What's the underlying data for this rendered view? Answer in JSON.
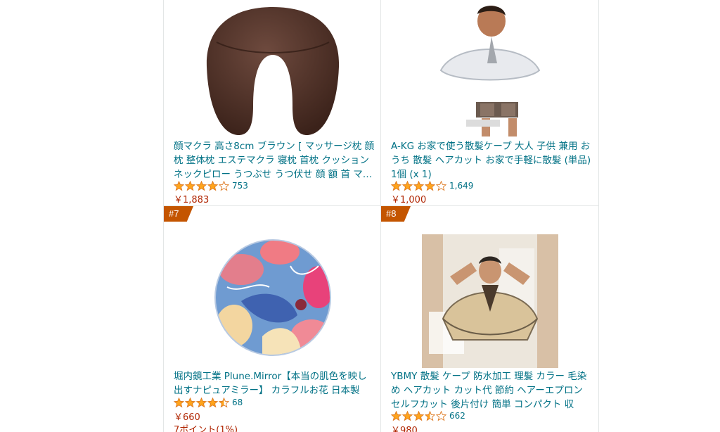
{
  "colors": {
    "link": "#007185",
    "price": "#b12704",
    "badge": "#c45500",
    "star": "#ffa41c",
    "divider": "#e3e6e6"
  },
  "products": [
    {
      "rank": "",
      "title": "顔マクラ 高さ8cm ブラウン [ マッサージ枕 顔枕 整体枕 エステマクラ 寝枕 首枕 クッション ネックピロー うつぶせ うつ伏せ 顔 額 首 マ…",
      "stars": 4.0,
      "review_count": "753",
      "price": "￥1,883",
      "points": "",
      "image_icon": "face-pillow-image"
    },
    {
      "rank": "",
      "title": "A-KG お家で使う散髪ケープ 大人 子供 兼用 おうち 散髪 ヘアカット お家で手軽に散髪 (単品) 1個 (x 1)",
      "stars": 4.0,
      "review_count": "1,649",
      "price": "￥1,000",
      "points": "",
      "image_icon": "haircut-cape-child-image"
    },
    {
      "rank": "#7",
      "title": "堀内鏡工業 Plune.Mirror【本当の肌色を映し出すナピュアミラー】 カラフルお花 日本製",
      "stars": 4.5,
      "review_count": "68",
      "price": "￥660",
      "points": "7ポイント(1%)",
      "image_icon": "floral-mirror-image"
    },
    {
      "rank": "#8",
      "title": "YBMY 散髪 ケープ 防水加工 理髪 カラー 毛染め ヘアカット カット代 節約 ヘアーエプロン セルフカット 後片付け 簡単 コンパクト 収納…",
      "stars": 3.5,
      "review_count": "662",
      "price": "￥980",
      "points": "",
      "image_icon": "haircut-cape-adult-image"
    }
  ]
}
